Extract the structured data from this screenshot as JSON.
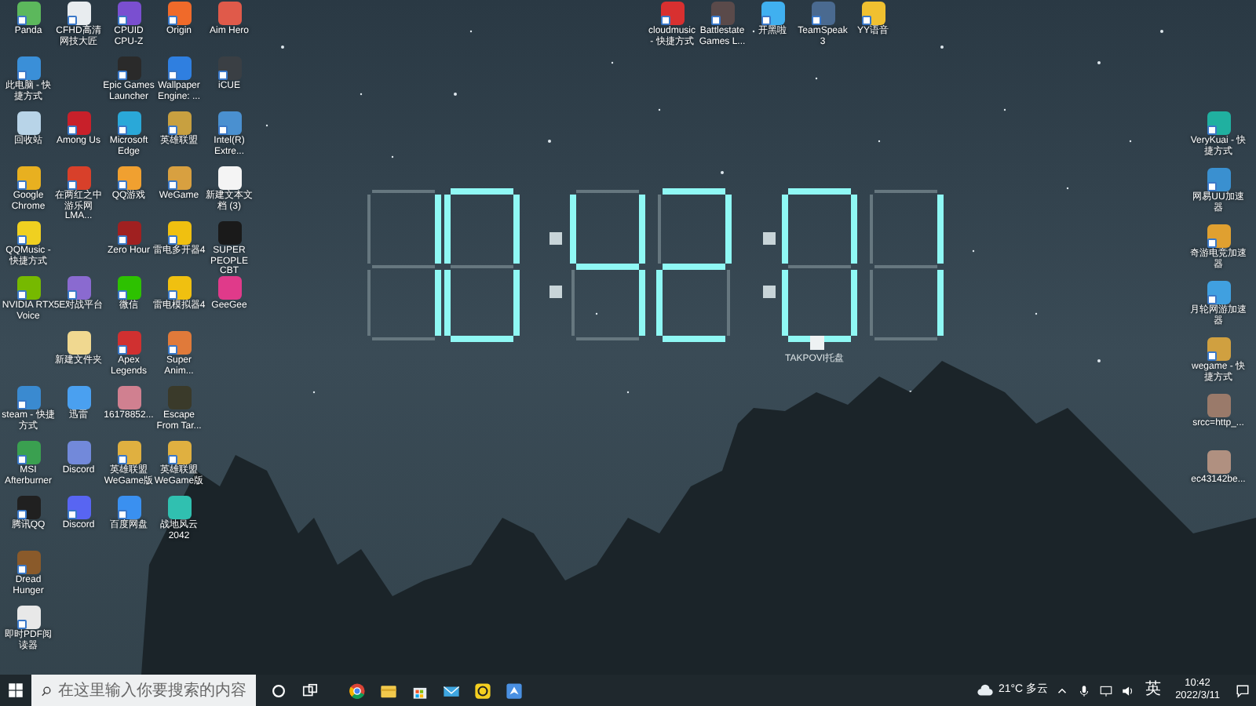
{
  "desktop": {
    "left_columns": [
      [
        [
          {
            "label": "Panda",
            "color": "#5cb85c",
            "shortcut": true
          },
          {
            "label": "此电脑 - 快捷方式",
            "color": "#3a8fd8",
            "shortcut": true
          },
          {
            "label": "回收站",
            "color": "#b8d4e8",
            "shortcut": false
          },
          {
            "label": "Google Chrome",
            "color": "#e8b020",
            "shortcut": true
          },
          {
            "label": "QQMusic - 快捷方式",
            "color": "#f0d020",
            "shortcut": true
          },
          {
            "label": "NVIDIA RTX Voice",
            "color": "#76b900",
            "shortcut": true
          }
        ],
        [
          {
            "label": "steam - 快捷方式",
            "color": "#3a8ad0",
            "shortcut": true
          },
          {
            "label": "MSI Afterburner",
            "color": "#3aa050",
            "shortcut": true
          },
          {
            "label": "腾讯QQ",
            "color": "#202020",
            "shortcut": true
          },
          {
            "label": "Dread Hunger",
            "color": "#8a5a2a",
            "shortcut": true
          },
          {
            "label": "即时PDF阅读器",
            "color": "#e8e8e8",
            "shortcut": true
          }
        ]
      ],
      [
        [
          {
            "label": "CFHD高清网技大匠",
            "color": "#e8ecef",
            "shortcut": true
          }
        ],
        [
          {
            "label": "Among Us",
            "color": "#c8202a",
            "shortcut": true
          },
          {
            "label": "在两红之中游乐网LMA...",
            "color": "#d8402a",
            "shortcut": true
          }
        ],
        [
          {
            "label": "5E对战平台",
            "color": "#8a6ad0",
            "shortcut": true
          },
          {
            "label": "新建文件夹",
            "color": "#f0d890",
            "shortcut": false
          },
          {
            "label": "迅雷",
            "color": "#4aa0f0",
            "shortcut": false
          },
          {
            "label": "Discord",
            "color": "#7289da",
            "shortcut": false
          },
          {
            "label": "Discord",
            "color": "#5865f2",
            "shortcut": true
          }
        ]
      ],
      [
        [
          {
            "label": "CPUID CPU-Z",
            "color": "#7a4fd0",
            "shortcut": true
          },
          {
            "label": "Epic Games Launcher",
            "color": "#2a2a2a",
            "shortcut": true
          },
          {
            "label": "Microsoft Edge",
            "color": "#2aa8d8",
            "shortcut": true
          },
          {
            "label": "QQ游戏",
            "color": "#f0a030",
            "shortcut": true
          },
          {
            "label": "Zero Hour",
            "color": "#a02020",
            "shortcut": true
          },
          {
            "label": "微信",
            "color": "#2dc100",
            "shortcut": true
          },
          {
            "label": "Apex Legends",
            "color": "#d03030",
            "shortcut": true
          },
          {
            "label": "16178852...",
            "color": "#d08090",
            "shortcut": false
          },
          {
            "label": "英雄联盟 WeGame版",
            "color": "#e0b040",
            "shortcut": true
          },
          {
            "label": "百度网盘",
            "color": "#3a90f0",
            "shortcut": true
          }
        ]
      ],
      [
        [
          {
            "label": "Origin",
            "color": "#f06a2a",
            "shortcut": true
          },
          {
            "label": "Wallpaper Engine: ...",
            "color": "#2f7fe0",
            "shortcut": true
          },
          {
            "label": "英雄联盟",
            "color": "#c8a040",
            "shortcut": true
          },
          {
            "label": "WeGame",
            "color": "#d8a040",
            "shortcut": true
          },
          {
            "label": "雷电多开器4",
            "color": "#f0c010",
            "shortcut": true
          },
          {
            "label": "雷电模拟器4",
            "color": "#f0c010",
            "shortcut": true
          },
          {
            "label": "Super Anim...",
            "color": "#e07a3a",
            "shortcut": true
          },
          {
            "label": "Escape From Tar...",
            "color": "#3a3a2a",
            "shortcut": false
          },
          {
            "label": "英雄联盟 WeGame版",
            "color": "#e0b040",
            "shortcut": true
          },
          {
            "label": "战地风云 2042",
            "color": "#30c0b0",
            "shortcut": false
          }
        ]
      ],
      [
        [
          {
            "label": "Aim Hero",
            "color": "#e05a4a",
            "shortcut": false
          },
          {
            "label": "iCUE",
            "color": "#3a3f44",
            "shortcut": true
          },
          {
            "label": "Intel(R) Extre...",
            "color": "#4a90d0",
            "shortcut": true
          },
          {
            "label": "新建文本文档 (3)",
            "color": "#f4f4f4",
            "shortcut": false
          },
          {
            "label": "SUPER PEOPLE CBT",
            "color": "#1a1a1a",
            "shortcut": false
          },
          {
            "label": "GeeGee",
            "color": "#e03a8a",
            "shortcut": false
          }
        ]
      ]
    ],
    "top_icons": [
      {
        "label": "cloudmusic - 快捷方式",
        "color": "#d83030",
        "shortcut": true
      },
      {
        "label": "Battlestate Games L...",
        "color": "#5a4a4a",
        "shortcut": true
      },
      {
        "label": "开黑啦",
        "color": "#40b0f0",
        "shortcut": true
      },
      {
        "label": "TeamSpeak 3",
        "color": "#4a6a90",
        "shortcut": true
      },
      {
        "label": "YY语音",
        "color": "#f0c030",
        "shortcut": true
      }
    ],
    "right_icons": [
      {
        "label": "VeryKuai - 快捷方式",
        "color": "#20b0a0",
        "shortcut": true
      },
      {
        "label": "网易UU加速器",
        "color": "#3a90d0",
        "shortcut": true
      },
      {
        "label": "奇游电竞加速器",
        "color": "#e0a030",
        "shortcut": true
      },
      {
        "label": "月轮网游加速器",
        "color": "#40a0e0",
        "shortcut": true
      },
      {
        "label": "wegame - 快捷方式",
        "color": "#d0a040",
        "shortcut": true
      },
      {
        "label": "srcc=http_...",
        "color": "#9a7a6a",
        "shortcut": false
      },
      {
        "label": "ec43142be...",
        "color": "#b09080",
        "shortcut": false
      }
    ]
  },
  "clock_widget": {
    "digits": [
      {
        "segments": [
          {
            "lit": false
          },
          {
            "lit": true
          },
          {
            "lit": true
          },
          {
            "lit": false
          },
          {
            "lit": false
          },
          {
            "lit": false
          },
          {
            "lit": false
          }
        ]
      },
      {
        "segments": [
          {
            "lit": true
          },
          {
            "lit": true
          },
          {
            "lit": true
          },
          {
            "lit": true
          },
          {
            "lit": true
          },
          {
            "lit": true
          },
          {
            "lit": false
          }
        ]
      },
      {
        "segments": [
          {
            "lit": false
          },
          {
            "lit": true
          },
          {
            "lit": true
          },
          {
            "lit": false
          },
          {
            "lit": false
          },
          {
            "lit": true
          },
          {
            "lit": true
          }
        ]
      },
      {
        "segments": [
          {
            "lit": true
          },
          {
            "lit": true
          },
          {
            "lit": false
          },
          {
            "lit": true
          },
          {
            "lit": true
          },
          {
            "lit": false
          },
          {
            "lit": true
          }
        ]
      },
      {
        "segments": [
          {
            "lit": true
          },
          {
            "lit": true
          },
          {
            "lit": true
          },
          {
            "lit": true
          },
          {
            "lit": true
          },
          {
            "lit": true
          },
          {
            "lit": false
          }
        ]
      },
      {
        "segments": [
          {
            "lit": false
          },
          {
            "lit": true
          },
          {
            "lit": true
          },
          {
            "lit": false
          },
          {
            "lit": false
          },
          {
            "lit": false
          },
          {
            "lit": false
          }
        ]
      }
    ],
    "caption": "TAKPOVI托盘"
  },
  "taskbar": {
    "search": {
      "placeholder": "在这里输入你要搜索的内容"
    },
    "weather": "21°C 多云",
    "ime": "英",
    "time": "10:42",
    "date": "2022/3/11"
  }
}
